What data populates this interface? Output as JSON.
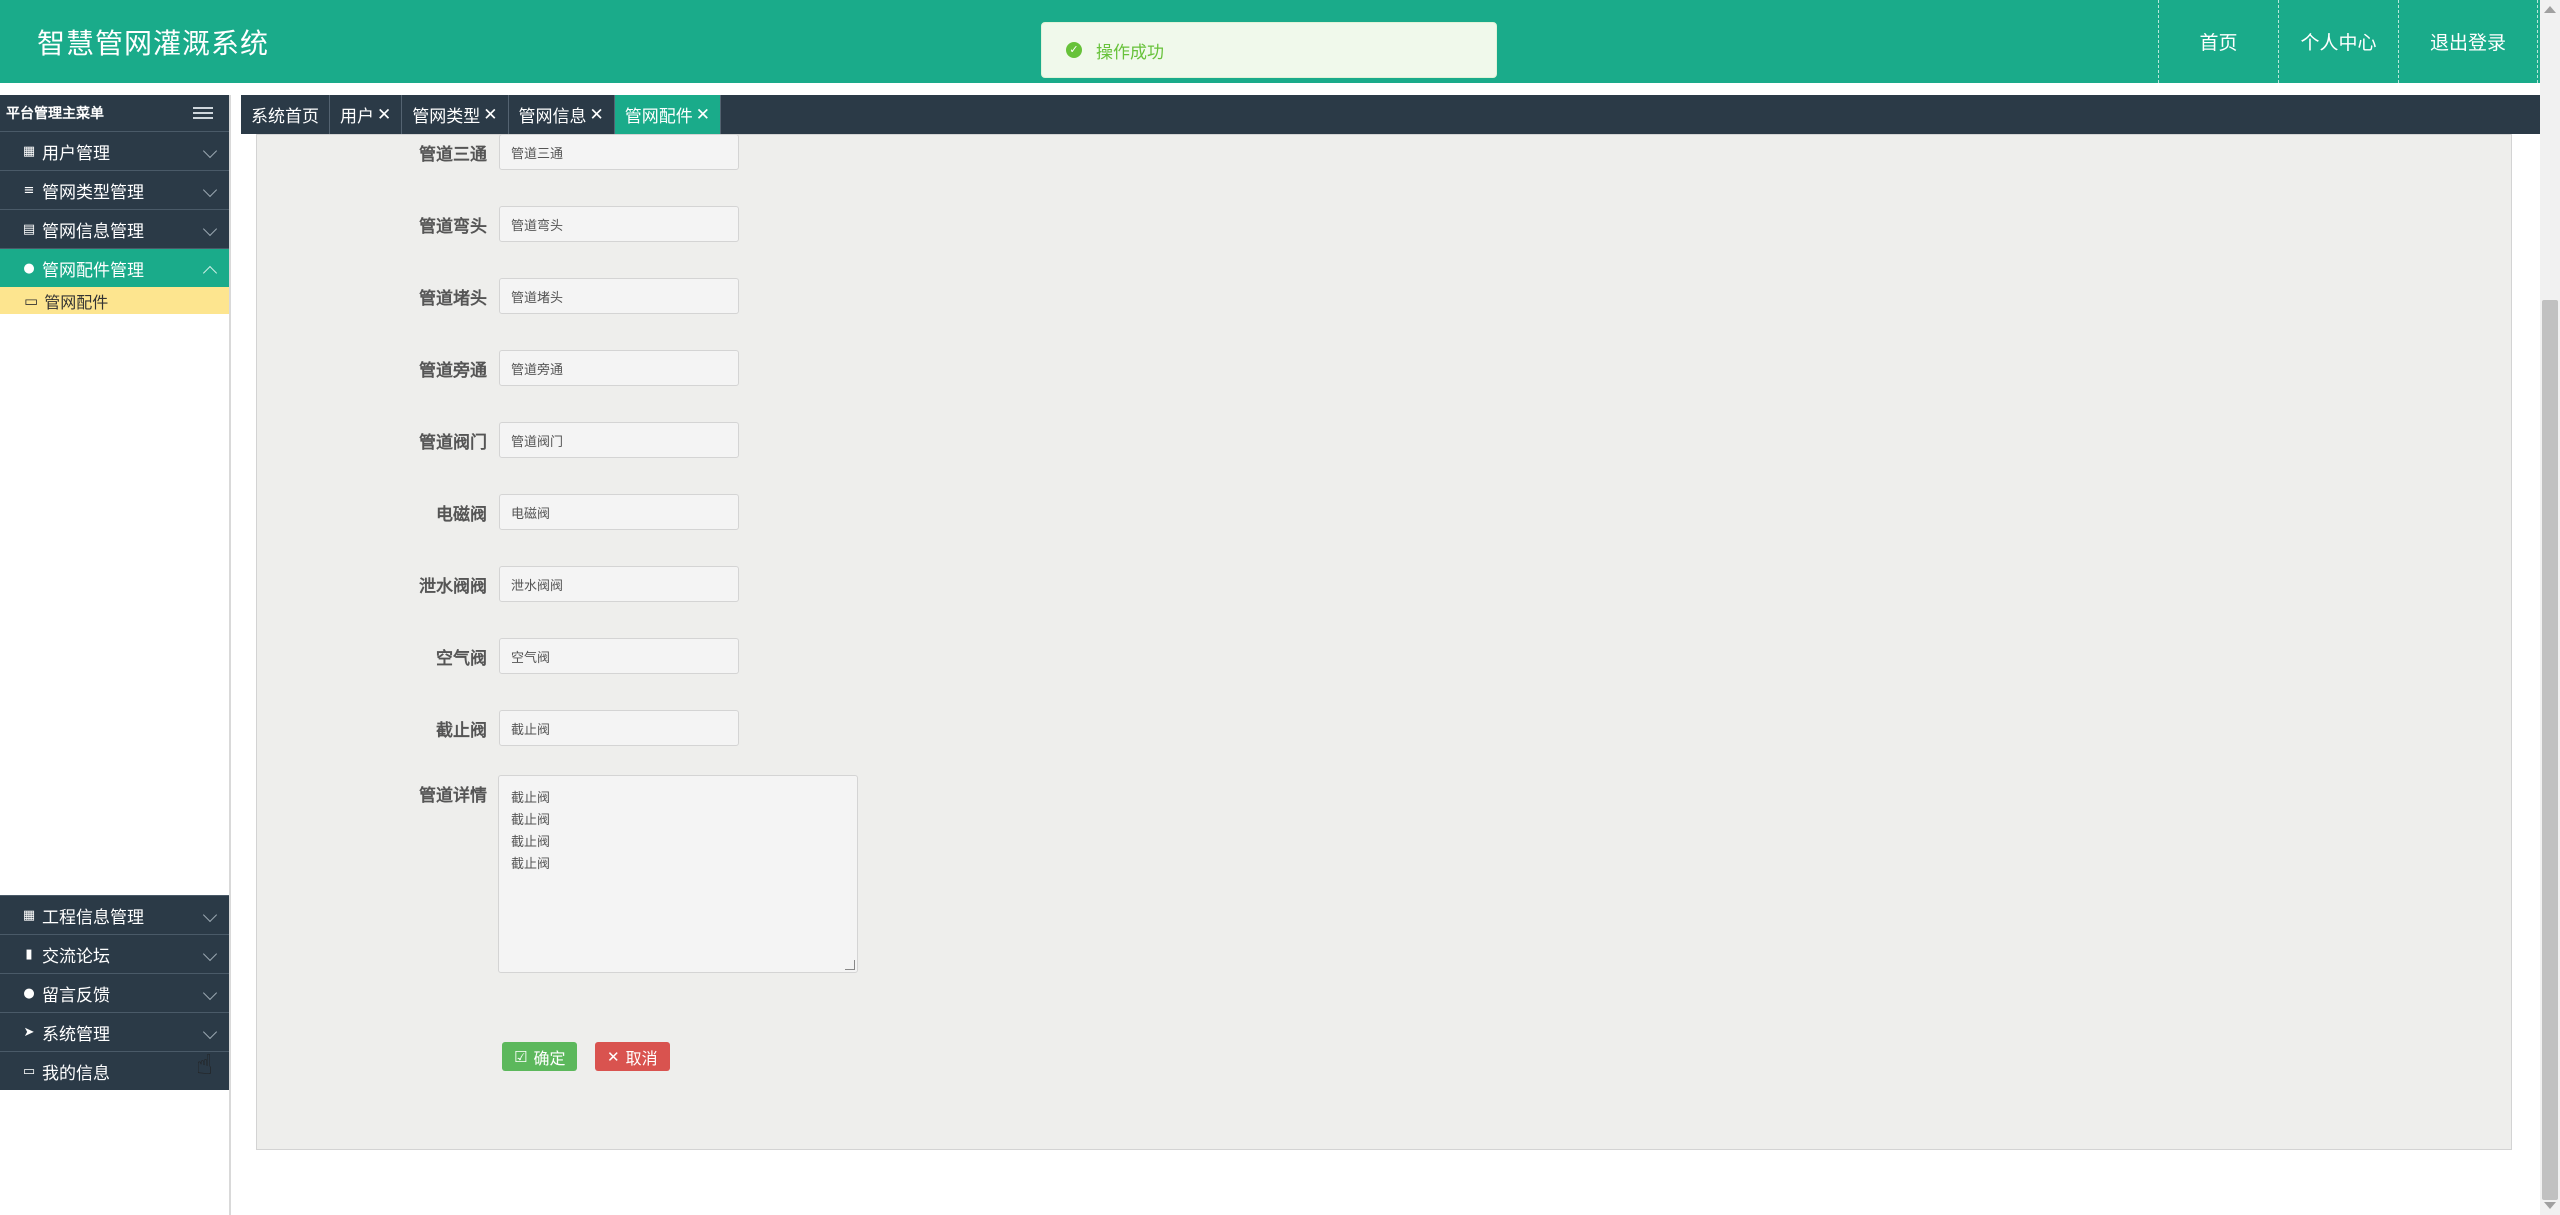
{
  "header": {
    "title": "智慧管网灌溉系统",
    "nav": [
      "首页",
      "个人中心",
      "退出登录"
    ]
  },
  "toast": {
    "icon": "check-icon",
    "text": "操作成功"
  },
  "sidebar": {
    "head": "平台管理主菜单",
    "items_top": [
      {
        "label": "用户管理",
        "icon": "grid-icon"
      },
      {
        "label": "管网类型管理",
        "icon": "list-icon"
      },
      {
        "label": "管网信息管理",
        "icon": "clipboard-icon"
      },
      {
        "label": "管网配件管理",
        "icon": "user-icon",
        "active": true
      }
    ],
    "sub_item": "管网配件",
    "items_bottom": [
      {
        "label": "工程信息管理",
        "icon": "grid-icon"
      },
      {
        "label": "交流论坛",
        "icon": "book-icon"
      },
      {
        "label": "留言反馈",
        "icon": "user-icon"
      },
      {
        "label": "系统管理",
        "icon": "send-icon"
      },
      {
        "label": "我的信息",
        "icon": "card-icon"
      }
    ]
  },
  "tabs": [
    {
      "label": "系统首页",
      "closable": false
    },
    {
      "label": "用户",
      "closable": true
    },
    {
      "label": "管网类型",
      "closable": true
    },
    {
      "label": "管网信息",
      "closable": true
    },
    {
      "label": "管网配件",
      "closable": true,
      "active": true
    }
  ],
  "form": {
    "fields": [
      {
        "label": "管道三通",
        "value": "管道三通"
      },
      {
        "label": "管道弯头",
        "value": "管道弯头"
      },
      {
        "label": "管道堵头",
        "value": "管道堵头"
      },
      {
        "label": "管道旁通",
        "value": "管道旁通"
      },
      {
        "label": "管道阀门",
        "value": "管道阀门"
      },
      {
        "label": "电磁阀",
        "value": "电磁阀"
      },
      {
        "label": "泄水阀阀",
        "value": "泄水阀阀"
      },
      {
        "label": "空气阀",
        "value": "空气阀"
      },
      {
        "label": "截止阀",
        "value": "截止阀"
      }
    ],
    "detail_label": "管道详情",
    "detail_lines": [
      "截止阀",
      "截止阀",
      "截止阀",
      "截止阀"
    ],
    "ok_label": "确定",
    "cancel_label": "取消"
  }
}
